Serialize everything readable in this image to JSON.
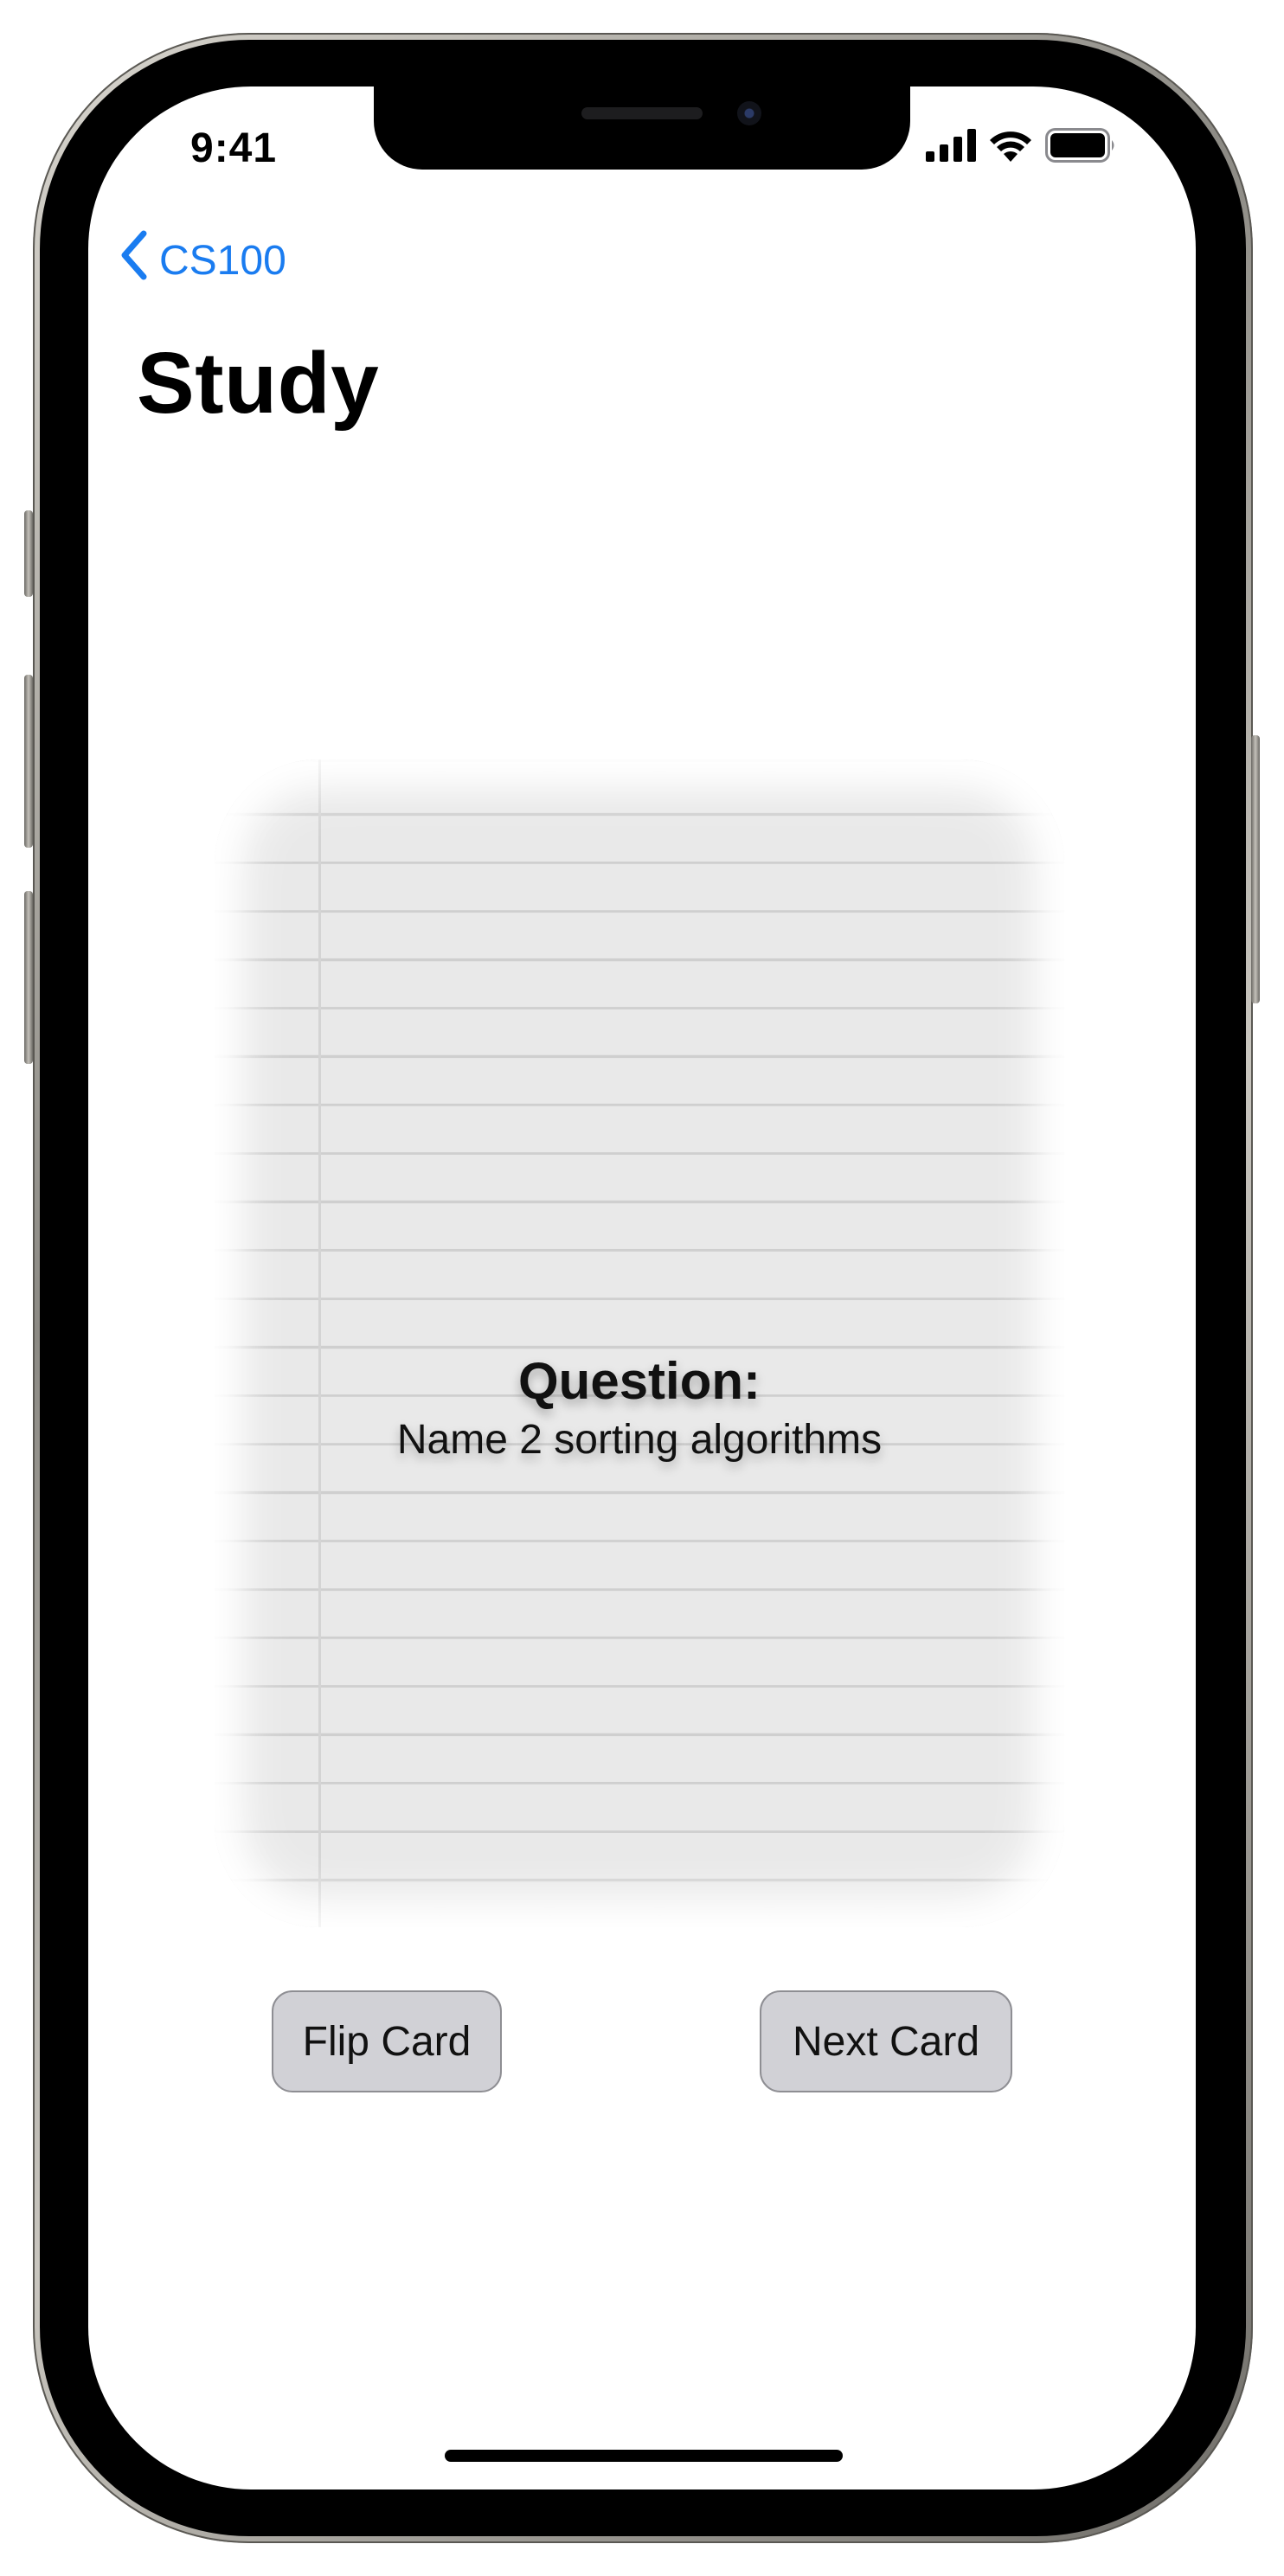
{
  "status_bar": {
    "time": "9:41",
    "icons": [
      "cellular-signal-icon",
      "wifi-icon",
      "battery-icon"
    ]
  },
  "nav": {
    "back_label": "CS100",
    "back_icon": "chevron-left-icon",
    "title": "Study"
  },
  "card": {
    "heading": "Question:",
    "body": "Name 2 sorting algorithms"
  },
  "actions": {
    "flip_label": "Flip Card",
    "next_label": "Next Card"
  },
  "colors": {
    "accent": "#1a7cf0",
    "button_fill": "#d1d1d6",
    "button_border": "#8e8e93",
    "card_paper": "#e9e9e9"
  }
}
